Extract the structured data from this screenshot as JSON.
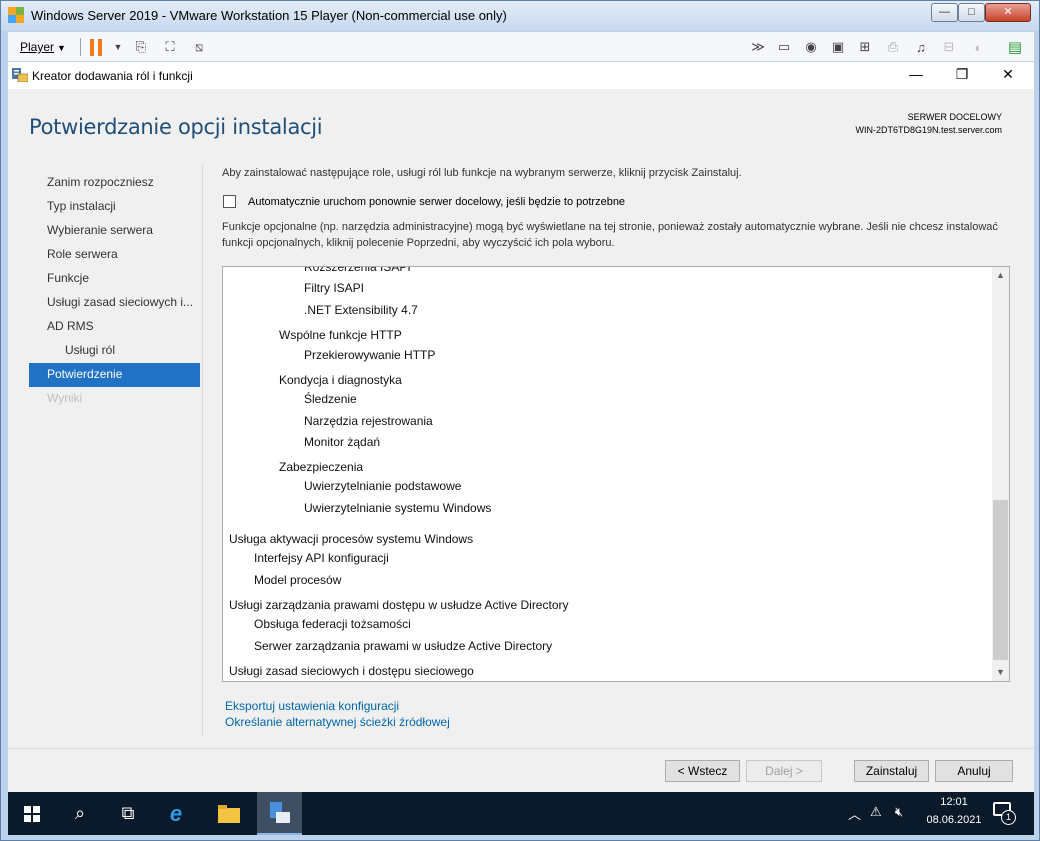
{
  "vmware": {
    "title": "Windows Server 2019 - VMware Workstation 15 Player (Non-commercial use only)",
    "player_menu": "Player",
    "controls": {
      "minimize": "—",
      "maximize": "□",
      "close": "✕"
    }
  },
  "wizard": {
    "title": "Kreator dodawania ról i funkcji",
    "controls": {
      "minimize": "—",
      "restore": "❐",
      "close": "✕"
    },
    "heading": "Potwierdzanie opcji instalacji",
    "destination_label": "SERWER DOCELOWY",
    "destination_server": "WIN-2DT6TD8G19N.test.server.com",
    "nav": [
      {
        "label": "Zanim rozpoczniesz",
        "state": "normal"
      },
      {
        "label": "Typ instalacji",
        "state": "normal"
      },
      {
        "label": "Wybieranie serwera",
        "state": "normal"
      },
      {
        "label": "Role serwera",
        "state": "normal"
      },
      {
        "label": "Funkcje",
        "state": "normal"
      },
      {
        "label": "Usługi zasad sieciowych i...",
        "state": "normal"
      },
      {
        "label": "AD RMS",
        "state": "normal"
      },
      {
        "label": "Usługi ról",
        "state": "sub"
      },
      {
        "label": "Potwierdzenie",
        "state": "active"
      },
      {
        "label": "Wyniki",
        "state": "disabled"
      }
    ],
    "intro": "Aby zainstalować następujące role, usługi ról lub funkcje na wybranym serwerze, kliknij przycisk Zainstaluj.",
    "restart_checkbox": {
      "checked": false,
      "label": "Automatycznie uruchom ponownie serwer docelowy, jeśli będzie to potrzebne"
    },
    "optional_note": "Funkcje opcjonalne (np. narzędzia administracyjne) mogą być wyświetlane na tej stronie, ponieważ zostały automatycznie wybrane. Jeśli nie chcesz instalować funkcji opcjonalnych, kliknij polecenie Poprzedni, aby wyczyścić ich pola wyboru.",
    "selection_list": [
      {
        "text": "Rozszerzenia ISAPI",
        "level": 3
      },
      {
        "text": "Filtry ISAPI",
        "level": 3
      },
      {
        "text": ".NET Extensibility 4.7",
        "level": 3
      },
      {
        "text": "Wspólne funkcje HTTP",
        "level": 2
      },
      {
        "text": "Przekierowywanie HTTP",
        "level": 3
      },
      {
        "text": "Kondycja i diagnostyka",
        "level": 2
      },
      {
        "text": "Śledzenie",
        "level": 3
      },
      {
        "text": "Narzędzia rejestrowania",
        "level": 3
      },
      {
        "text": "Monitor żądań",
        "level": 3
      },
      {
        "text": "Zabezpieczenia",
        "level": 2
      },
      {
        "text": "Uwierzytelnianie podstawowe",
        "level": 3
      },
      {
        "text": "Uwierzytelnianie systemu Windows",
        "level": 3
      },
      {
        "text": "Usługa aktywacji procesów systemu Windows",
        "level": 0
      },
      {
        "text": "Interfejsy API konfiguracji",
        "level": 1
      },
      {
        "text": "Model procesów",
        "level": 1
      },
      {
        "text": "Usługi zarządzania prawami dostępu w usłudze Active Directory",
        "level": 0
      },
      {
        "text": "Obsługa federacji tożsamości",
        "level": 1
      },
      {
        "text": "Serwer zarządzania prawami w usłudze Active Directory",
        "level": 1
      },
      {
        "text": "Usługi zasad sieciowych i dostępu sieciowego",
        "level": 0
      }
    ],
    "links": {
      "export": "Eksportuj ustawienia konfiguracji",
      "alt_source": "Określanie alternatywnej ścieżki źródłowej"
    },
    "buttons": {
      "back": "< Wstecz",
      "next": "Dalej >",
      "install": "Zainstaluj",
      "cancel": "Anuluj"
    }
  },
  "taskbar": {
    "time": "12:01",
    "date": "08.06.2021",
    "notification_count": "1"
  },
  "colors": {
    "heading": "#1f4e79",
    "nav_active": "#2073c4",
    "link": "#0066aa",
    "taskbar": "#0b1a2b"
  }
}
